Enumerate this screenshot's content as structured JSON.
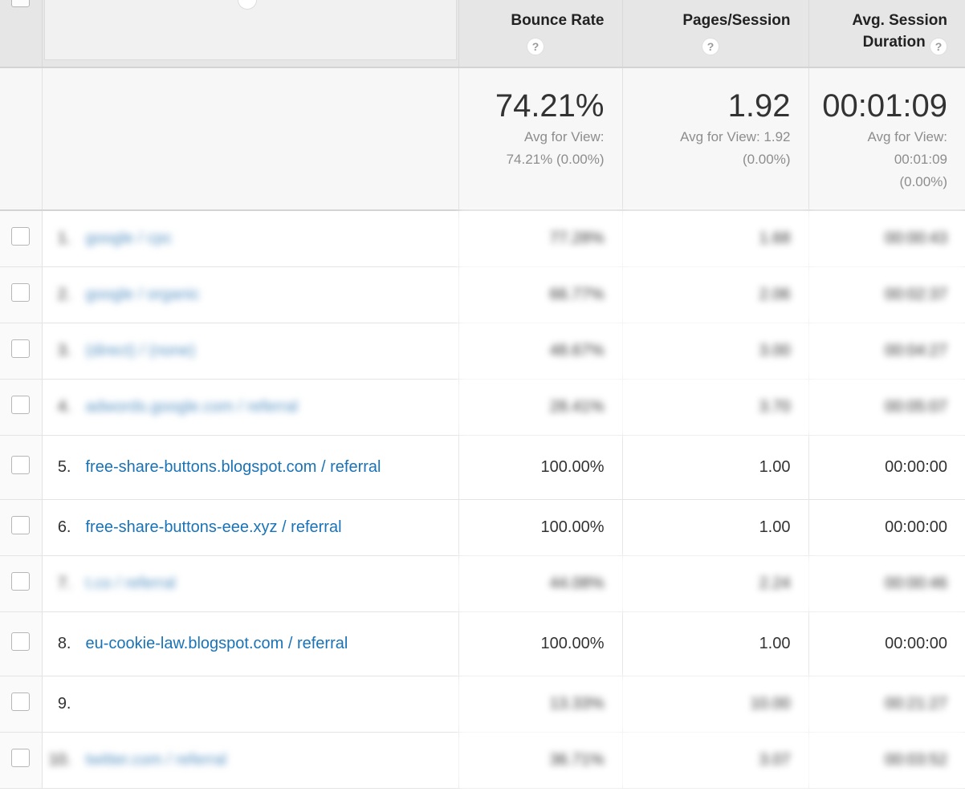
{
  "table": {
    "columns": [
      {
        "key": "checkbox",
        "label": "",
        "icon": "select-all-checkbox"
      },
      {
        "key": "dimension",
        "label": "",
        "icon": "help-icon"
      },
      {
        "key": "bounce_rate",
        "label": "Bounce Rate",
        "help": "?"
      },
      {
        "key": "pages_session",
        "label": "Pages/Session",
        "help": "?"
      },
      {
        "key": "avg_session_duration",
        "label_line1": "Avg. Session",
        "label_line2": "Duration",
        "help": "?"
      }
    ],
    "summary": {
      "bounce_rate": {
        "value": "74.21%",
        "sub_line1": "Avg for View:",
        "sub_line2": "74.21% (0.00%)"
      },
      "pages_session": {
        "value": "1.92",
        "sub_line1": "Avg for View: 1.92",
        "sub_line2": "(0.00%)"
      },
      "avg_session_duration": {
        "value": "00:01:09",
        "sub_line1": "Avg for View:",
        "sub_line2": "00:01:09",
        "sub_line3": "(0.00%)"
      }
    },
    "rows": [
      {
        "index": "1.",
        "label": "google / cpc",
        "bounce_rate": "77.28%",
        "pages_session": "1.68",
        "avg_session_duration": "00:00:43",
        "redacted": true,
        "height": "short"
      },
      {
        "index": "2.",
        "label": "google / organic",
        "bounce_rate": "66.77%",
        "pages_session": "2.06",
        "avg_session_duration": "00:02:37",
        "redacted": true,
        "height": "short"
      },
      {
        "index": "3.",
        "label": "(direct) / (none)",
        "bounce_rate": "48.67%",
        "pages_session": "3.00",
        "avg_session_duration": "00:04:27",
        "redacted": true,
        "height": "short"
      },
      {
        "index": "4.",
        "label": "adwords.google.com / referral",
        "bounce_rate": "28.41%",
        "pages_session": "3.70",
        "avg_session_duration": "00:05:07",
        "redacted": true,
        "height": "short"
      },
      {
        "index": "5.",
        "label": "free-share-buttons.blogspot.com / referral",
        "bounce_rate": "100.00%",
        "pages_session": "1.00",
        "avg_session_duration": "00:00:00",
        "redacted": false,
        "height": "tall"
      },
      {
        "index": "6.",
        "label": "free-share-buttons-eee.xyz / referral",
        "bounce_rate": "100.00%",
        "pages_session": "1.00",
        "avg_session_duration": "00:00:00",
        "redacted": false,
        "height": "short"
      },
      {
        "index": "7.",
        "label": "t.co / referral",
        "bounce_rate": "44.08%",
        "pages_session": "2.24",
        "avg_session_duration": "00:00:46",
        "redacted": true,
        "height": "short"
      },
      {
        "index": "8.",
        "label": "eu-cookie-law.blogspot.com / referral",
        "bounce_rate": "100.00%",
        "pages_session": "1.00",
        "avg_session_duration": "00:00:00",
        "redacted": false,
        "height": "tall"
      },
      {
        "index": "9.",
        "label": "",
        "bounce_rate": "13.33%",
        "pages_session": "10.00",
        "avg_session_duration": "00:21:27",
        "redacted": true,
        "index_visible": true,
        "height": "short"
      },
      {
        "index": "10.",
        "label": "twitter.com / referral",
        "bounce_rate": "36.71%",
        "pages_session": "3.07",
        "avg_session_duration": "00:03:52",
        "redacted": true,
        "height": "short"
      }
    ]
  },
  "colors": {
    "link": "#1a73b7",
    "header_bg": "#e6e6e6",
    "summary_bg": "#f7f7f7",
    "text": "#333333",
    "muted": "#8d8d8d"
  }
}
